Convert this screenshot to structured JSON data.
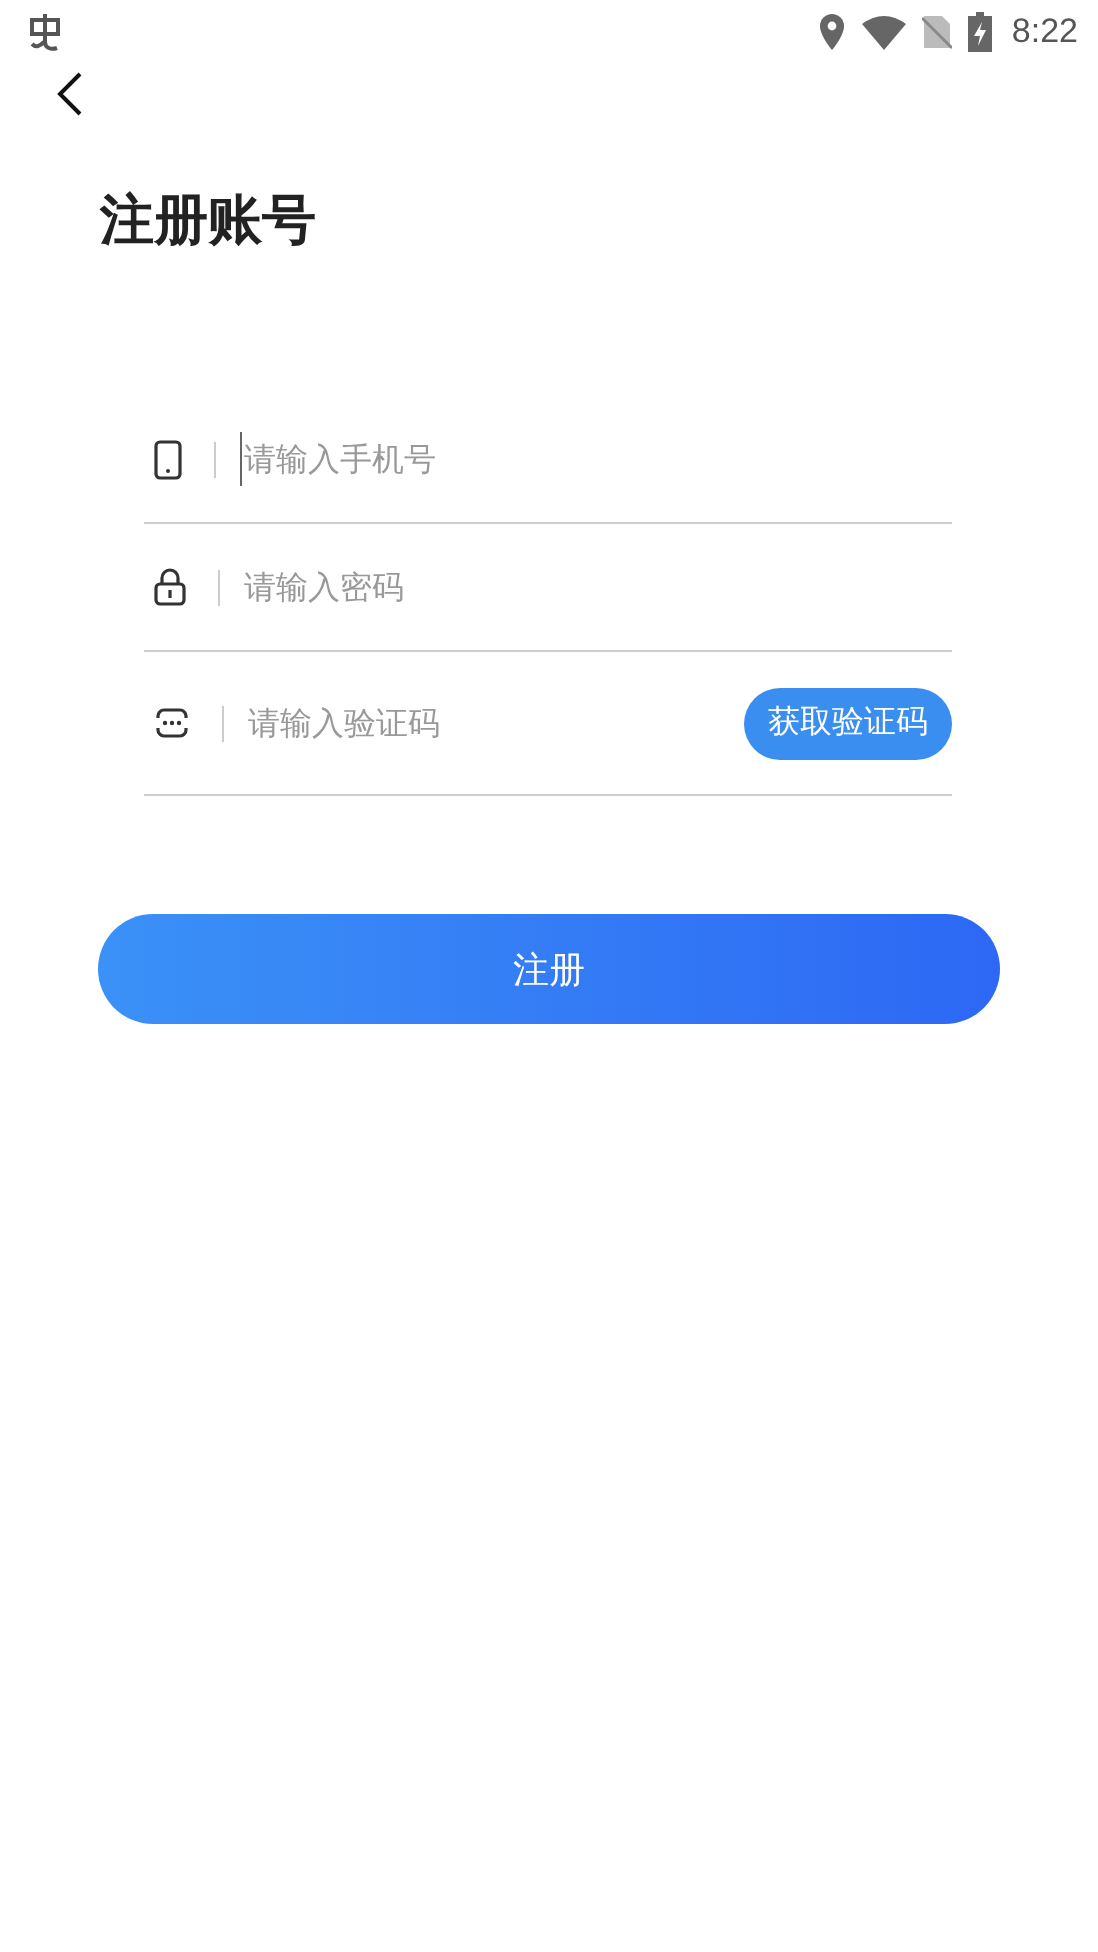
{
  "status_bar": {
    "time": "8:22"
  },
  "title": "注册账号",
  "fields": [
    {
      "kind": "phone",
      "placeholder": "请输入手机号",
      "focused": true
    },
    {
      "kind": "password",
      "placeholder": "请输入密码",
      "focused": false
    },
    {
      "kind": "code",
      "placeholder": "请输入验证码",
      "focused": false,
      "action": "获取验证码"
    }
  ],
  "submit": "注册"
}
